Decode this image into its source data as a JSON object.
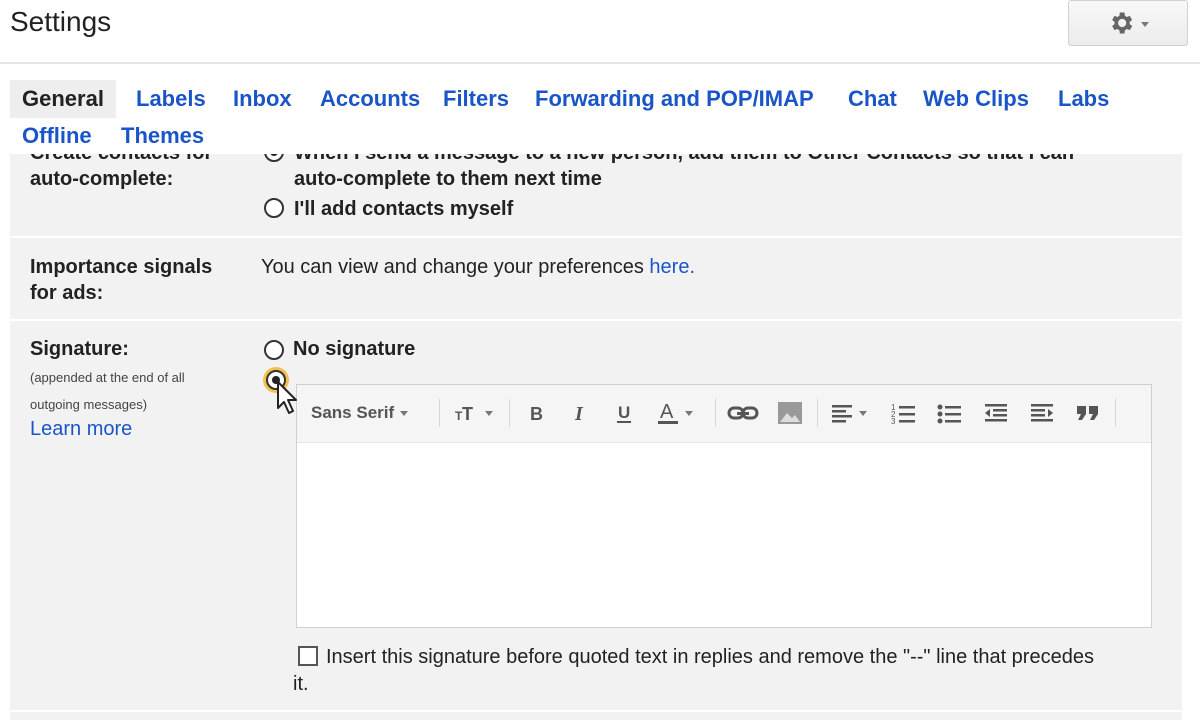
{
  "header": {
    "title": "Settings",
    "gear_icon": "gear-icon"
  },
  "tabs": [
    {
      "label": "General",
      "active": true
    },
    {
      "label": "Labels"
    },
    {
      "label": "Inbox"
    },
    {
      "label": "Accounts"
    },
    {
      "label": "Filters"
    },
    {
      "label": "Forwarding and POP/IMAP"
    },
    {
      "label": "Chat"
    },
    {
      "label": "Web Clips"
    },
    {
      "label": "Labs"
    },
    {
      "label": "Offline"
    },
    {
      "label": "Themes"
    }
  ],
  "contacts": {
    "label_line1": "Create contacts for",
    "label_line2": "auto-complete:",
    "option1_line1": "When I send a message to a new person, add them to Other Contacts so that I can",
    "option1_line2": "auto-complete to them next time",
    "option2": "I'll add contacts myself"
  },
  "importance": {
    "label_line1": "Importance signals",
    "label_line2": "for ads:",
    "text": "You can view and change your preferences",
    "link": "here."
  },
  "signature": {
    "label": "Signature:",
    "hint_line1": "(appended at the end of all",
    "hint_line2": "outgoing messages)",
    "learn_more": "Learn more",
    "no_signature": "No signature",
    "font_name": "Sans Serif",
    "insert_before_line1": "Insert this signature before quoted text in replies and remove the \"--\" line that precedes",
    "insert_before_line2": "it."
  }
}
